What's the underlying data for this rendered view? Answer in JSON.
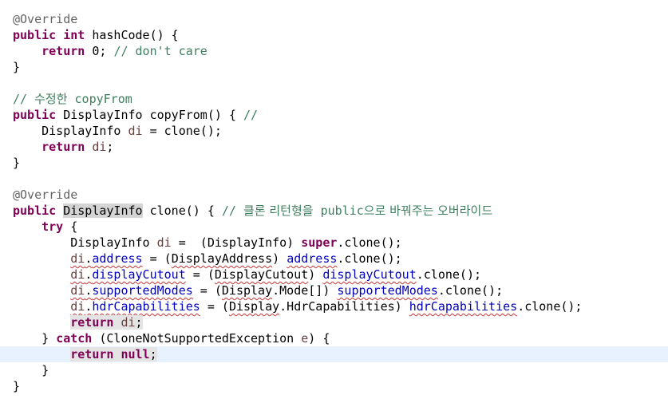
{
  "editor": {
    "lines": [
      [
        {
          "t": "@Override",
          "c": "annotation"
        }
      ],
      [
        {
          "t": "public",
          "c": "keyword"
        },
        {
          "t": " "
        },
        {
          "t": "int",
          "c": "keyword"
        },
        {
          "t": " hashCode() {"
        }
      ],
      [
        {
          "t": "    "
        },
        {
          "t": "return",
          "c": "keyword"
        },
        {
          "t": " 0; "
        },
        {
          "t": "// don't care",
          "c": "comment"
        }
      ],
      [
        {
          "t": "}"
        }
      ],
      [],
      [
        {
          "t": "// ",
          "c": "comment"
        },
        {
          "t": "수정한",
          "c": "comment",
          "ko": true
        },
        {
          "t": " copyFrom",
          "c": "comment"
        }
      ],
      [
        {
          "t": "public",
          "c": "keyword"
        },
        {
          "t": " DisplayInfo copyFrom() { "
        },
        {
          "t": "//",
          "c": "comment"
        }
      ],
      [
        {
          "t": "    DisplayInfo "
        },
        {
          "t": "di",
          "c": "local"
        },
        {
          "t": " = clone();"
        }
      ],
      [
        {
          "t": "    "
        },
        {
          "t": "return",
          "c": "keyword"
        },
        {
          "t": " "
        },
        {
          "t": "di",
          "c": "local"
        },
        {
          "t": ";"
        }
      ],
      [
        {
          "t": "}"
        }
      ],
      [],
      [
        {
          "t": "@Override",
          "c": "annotation"
        }
      ],
      [
        {
          "t": "public",
          "c": "keyword"
        },
        {
          "t": " "
        },
        {
          "t": "DisplayInfo",
          "hl": true
        },
        {
          "t": " clone() { "
        },
        {
          "t": "// ",
          "c": "comment"
        },
        {
          "t": "클론 리턴형을",
          "c": "comment",
          "ko": true
        },
        {
          "t": " public",
          "c": "comment"
        },
        {
          "t": "으로 바꿔주는 오버라이드",
          "c": "comment",
          "ko": true
        }
      ],
      [
        {
          "t": "    "
        },
        {
          "t": "try",
          "c": "keyword"
        },
        {
          "t": " {"
        }
      ],
      [
        {
          "t": "        DisplayInfo "
        },
        {
          "t": "di",
          "c": "local"
        },
        {
          "t": " =  (DisplayInfo) "
        },
        {
          "t": "super",
          "c": "keyword"
        },
        {
          "t": ".clone();"
        }
      ],
      [
        {
          "t": "        "
        },
        {
          "t": "di",
          "c": "local",
          "sq": true
        },
        {
          "t": ".",
          "sq": true
        },
        {
          "t": "address",
          "c": "field",
          "sq": true
        },
        {
          "t": " = ("
        },
        {
          "t": "DisplayAddress",
          "sq": true
        },
        {
          "t": ") "
        },
        {
          "t": "address",
          "c": "field",
          "sq": true
        },
        {
          "t": ".clone();"
        }
      ],
      [
        {
          "t": "        "
        },
        {
          "t": "di",
          "c": "local",
          "sq": true
        },
        {
          "t": ".",
          "sq": true
        },
        {
          "t": "displayCutout",
          "c": "field",
          "sq": true
        },
        {
          "t": " = ("
        },
        {
          "t": "DisplayCutout",
          "sq": true
        },
        {
          "t": ") "
        },
        {
          "t": "displayCutout",
          "c": "field",
          "sq": true
        },
        {
          "t": ".clone();"
        }
      ],
      [
        {
          "t": "        "
        },
        {
          "t": "di",
          "c": "local",
          "sq": true
        },
        {
          "t": ".",
          "sq": true
        },
        {
          "t": "supportedModes",
          "c": "field",
          "sq": true
        },
        {
          "t": " = ("
        },
        {
          "t": "Display",
          "sq": true
        },
        {
          "t": ".Mode[]) "
        },
        {
          "t": "supportedModes",
          "c": "field",
          "sq": true
        },
        {
          "t": ".clone();"
        }
      ],
      [
        {
          "t": "        "
        },
        {
          "t": "di",
          "c": "local",
          "sq": true
        },
        {
          "t": ".",
          "sq": true
        },
        {
          "t": "hdrCapabilities",
          "c": "field",
          "sq": true
        },
        {
          "t": " = ("
        },
        {
          "t": "Display",
          "sq": true
        },
        {
          "t": ".HdrCapabilities) "
        },
        {
          "t": "hdrCapabilities",
          "c": "field",
          "sq": true
        },
        {
          "t": ".clone();"
        }
      ],
      [
        {
          "t": "        "
        },
        {
          "t": "return",
          "c": "keyword",
          "mark": true
        },
        {
          "t": " ",
          "mark": true
        },
        {
          "t": "di",
          "c": "local",
          "mark": true
        },
        {
          "t": ";",
          "mark": true
        }
      ],
      [
        {
          "t": "    } "
        },
        {
          "t": "catch",
          "c": "keyword"
        },
        {
          "t": " (CloneNotSupportedException "
        },
        {
          "t": "e",
          "c": "local"
        },
        {
          "t": ") {"
        }
      ],
      [
        {
          "t": "        "
        },
        {
          "t": "return",
          "c": "keyword",
          "mark": true,
          "caret": true
        },
        {
          "t": " ",
          "mark": true
        },
        {
          "t": "null",
          "c": "keyword",
          "mark": true
        },
        {
          "t": ";",
          "mark": true
        }
      ],
      [
        {
          "t": "    }"
        }
      ],
      [
        {
          "t": "}"
        }
      ]
    ],
    "current_line_index": 21
  },
  "colors": {
    "keyword": "#7f0055",
    "comment": "#3f7f5f",
    "annotation": "#646464",
    "field": "#0000c0",
    "local": "#6a3e3e",
    "current_line": "#e8f2fe",
    "occurrence_highlight": "#d4d4d4",
    "error_squiggle": "#cc3333"
  }
}
